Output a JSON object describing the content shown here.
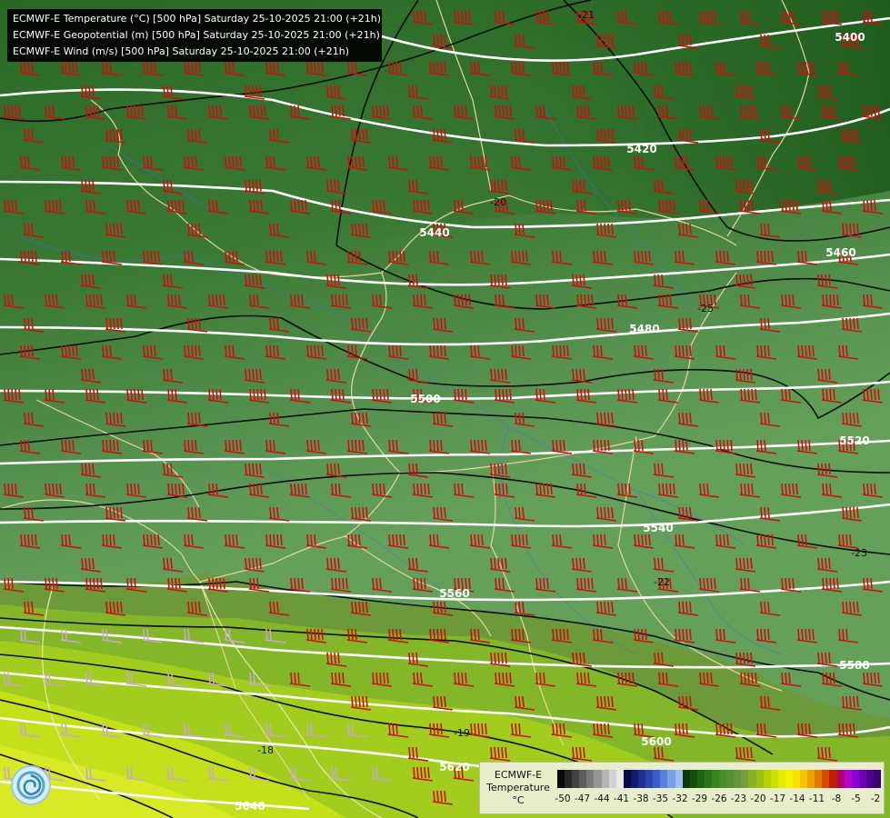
{
  "titles": [
    "ECMWF-E Temperature (°C) [500 hPa] Saturday 25-10-2025 21:00 (+21h)",
    "ECMWF-E Geopotential (m) [500 hPa] Saturday 25-10-2025 21:00 (+21h)",
    "ECMWF-E Wind (m/s) [500 hPa] Saturday 25-10-2025 21:00 (+21h)"
  ],
  "geopotential_labels": [
    "5400",
    "5420",
    "5440",
    "5460",
    "5480",
    "5500",
    "5520",
    "5540",
    "5560",
    "5580",
    "5600",
    "5620",
    "5640"
  ],
  "temperature_labels": [
    "-18",
    "-19",
    "-20",
    "-21",
    "-22",
    "-23",
    "-25"
  ],
  "legend": {
    "title_line1": "ECMWF-E",
    "title_line2": "Temperature",
    "title_line3": "°C",
    "ticks": [
      "-50",
      "-47",
      "-44",
      "-41",
      "-38",
      "-35",
      "-32",
      "-29",
      "-26",
      "-23",
      "-20",
      "-17",
      "-14",
      "-11",
      "-8",
      "-5",
      "-2"
    ],
    "colors": [
      "#0a0a0a",
      "#262626",
      "#424242",
      "#5e5e5e",
      "#7a7a7a",
      "#969696",
      "#b4b4b4",
      "#d2d2d2",
      "#e8e8e8",
      "#0a0a4a",
      "#141a6e",
      "#1e2f92",
      "#2a46b0",
      "#3b61c8",
      "#5a80dc",
      "#7aa0ea",
      "#9cc0f4",
      "#0a3a0a",
      "#15500f",
      "#1f6414",
      "#2a7419",
      "#38841e",
      "#468c2a",
      "#558f34",
      "#64963e",
      "#74a03c",
      "#88b024",
      "#9cc012",
      "#b4d200",
      "#cce000",
      "#e4ec00",
      "#f4f400",
      "#f8e200",
      "#f4c400",
      "#eca200",
      "#e07a00",
      "#d24c00",
      "#c01e00",
      "#b0006a",
      "#b400d2",
      "#8c00d8",
      "#6c00b0",
      "#4e0090",
      "#3a0070"
    ]
  },
  "colors": {
    "cold_green": "#2e6a29",
    "mid_green": "#5e9a56",
    "warm_yellow": "#d7ea23",
    "wind_cold": "#cc0000",
    "wind_warm": "#c8a8c8",
    "geopotential_line": "#ffffff",
    "isotherm_line": "#000000",
    "border_line": "#e0d39a",
    "river_line": "#3c6fd8"
  },
  "icons": {
    "logo": "ecmwf-swirl-logo",
    "wind_barbs": "wind-barb-icon"
  }
}
